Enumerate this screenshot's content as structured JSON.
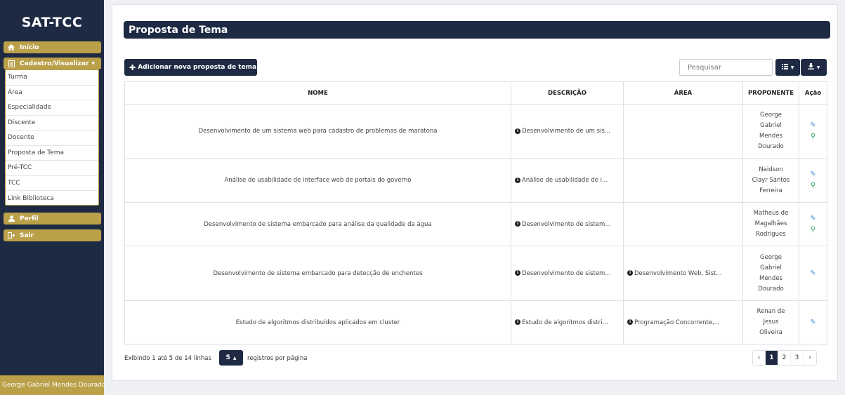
{
  "sidebar": {
    "brand": "SAT-TCC",
    "inicio": "Início",
    "cadastro": "Cadastro/Visualizar",
    "submenu": [
      "Turma",
      "Área",
      "Especialidade",
      "Discente",
      "Docente",
      "Proposta de Tema",
      "Pré-TCC",
      "TCC",
      "Link Biblioteca"
    ],
    "perfil": "Perfil",
    "sair": "Sair",
    "user": "George Gabriel Mendes Dourado"
  },
  "page": {
    "title": "Proposta de Tema",
    "add_button": "Adicionar nova proposta de tema",
    "search_placeholder": "Pesquisar"
  },
  "table": {
    "headers": {
      "nome": "NOME",
      "descricao": "DESCRIÇÃO",
      "area": "ÁREA",
      "proponente": "PROPONENTE",
      "acao": "Ação"
    },
    "rows": [
      {
        "nome": "Desenvolvimento de um sistema web para cadastro de problemas de maratona",
        "descricao": "Desenvolvimento de um sis...",
        "area": "",
        "proponente": [
          "George",
          "Gabriel",
          "Mendes",
          "Dourado"
        ],
        "view": true
      },
      {
        "nome": "Análise de usabilidade de interface web de portais do governo",
        "descricao": "Análise de usabilidade de i...",
        "area": "",
        "proponente": [
          "Naidson",
          "Clayr Santos",
          "Ferreira"
        ],
        "view": true
      },
      {
        "nome": "Desenvolvimento de sistema embarcado para análise da qualidade da água",
        "descricao": "Desenvolvimento de sistem...",
        "area": "",
        "proponente": [
          "Matheus de",
          "Magalhães",
          "Rodrigues"
        ],
        "view": true
      },
      {
        "nome": "Desenvolvimento de sistema embarcado para detecção de enchentes",
        "descricao": "Desenvolvimento de sistem...",
        "area": "Desenvolvimento Web, Sist...",
        "proponente": [
          "George",
          "Gabriel",
          "Mendes",
          "Dourado"
        ],
        "view": false
      },
      {
        "nome": "Estudo de algoritmos distribuídos aplicados em cluster",
        "descricao": "Estudo de algoritmos distri...",
        "area": "Programação Concorrente,...",
        "proponente": [
          "Renan de",
          "Jesus",
          "Oliveira"
        ],
        "view": false
      }
    ]
  },
  "footer": {
    "info": "Exibindo 1 até 5 de 14 linhas",
    "page_size": "5",
    "rpp": "registros por página",
    "pages": [
      "1",
      "2",
      "3"
    ],
    "prev": "‹",
    "next": "›"
  }
}
